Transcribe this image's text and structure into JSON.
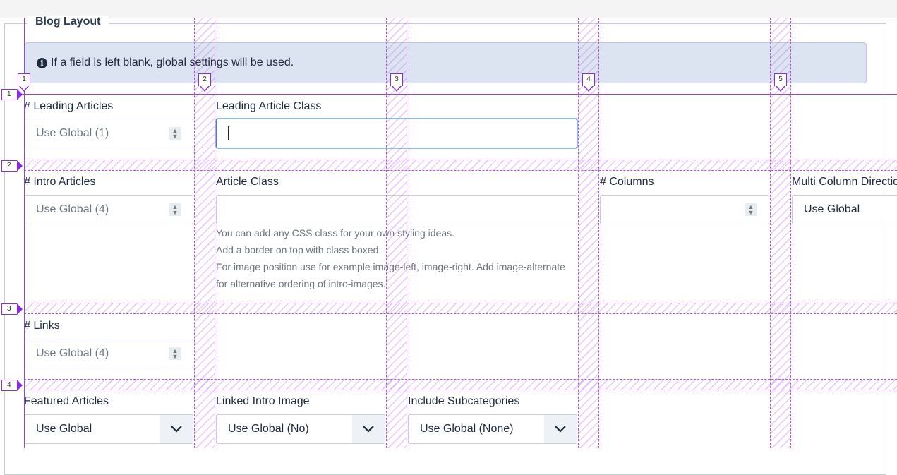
{
  "legend": "Blog Layout",
  "info": {
    "icon": "info-circle-icon",
    "text": "If a field is left blank, global settings will be used."
  },
  "fields": {
    "leading_articles": {
      "label": "# Leading Articles",
      "placeholder": "Use Global (1)"
    },
    "leading_article_class": {
      "label": "Leading Article Class",
      "value": ""
    },
    "intro_articles": {
      "label": "# Intro Articles",
      "placeholder": "Use Global (4)"
    },
    "article_class": {
      "label": "Article Class",
      "value": ""
    },
    "columns": {
      "label": "# Columns",
      "placeholder": ""
    },
    "multi_column_direction": {
      "label": "Multi Column Directio",
      "value": "Use Global"
    },
    "links": {
      "label": "# Links",
      "placeholder": "Use Global (4)"
    },
    "featured_articles": {
      "label": "Featured Articles",
      "value": "Use Global"
    },
    "linked_intro_image": {
      "label": "Linked Intro Image",
      "value": "Use Global (No)"
    },
    "include_subcategories": {
      "label": "Include Subcategories",
      "value": "Use Global (None)"
    }
  },
  "article_class_help": [
    "You can add any CSS class for your own styling ideas.",
    "Add a border on top with class boxed.",
    "For image position use for example image-left, image-right. Add image-alternate",
    "for alternative ordering of intro-images."
  ],
  "grid_overlay": {
    "column_markers": [
      "1",
      "2",
      "3",
      "4",
      "5"
    ],
    "row_markers": [
      "1",
      "2",
      "3",
      "4"
    ],
    "color": "#8a2be2"
  },
  "colors": {
    "info_bg": "#dde4f1",
    "focus_border": "#4a7ec2",
    "text": "#1d2a3d",
    "muted": "#6c757d"
  }
}
